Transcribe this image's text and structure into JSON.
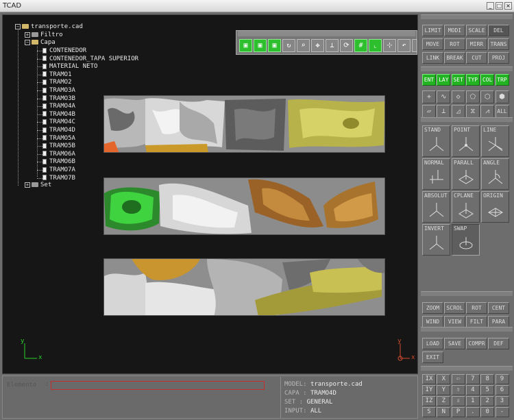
{
  "window": {
    "title": "TCAD"
  },
  "tree": {
    "root": "transporte.cad",
    "filtro": "Filtro",
    "capa": "Capa",
    "layers": [
      "CONTENEDOR",
      "CONTENEDOR_TAPA SUPERIOR",
      "MATERIAL NETO",
      "TRAMO1",
      "TRAMO2",
      "TRAMO3A",
      "TRAMO3B",
      "TRAMO4A",
      "TRAMO4B",
      "TRAMO4C",
      "TRAMO4D",
      "TRAMO5A",
      "TRAMO5B",
      "TRAMO6A",
      "TRAMO6B",
      "TRAMO7A",
      "TRAMO7B"
    ],
    "set": "Set"
  },
  "axes": {
    "left_y": "y",
    "left_x": "x",
    "right_y": "y",
    "right_x": "x"
  },
  "tools": {
    "row1": [
      "LIMIT",
      "MODI",
      "SCALE",
      "DEL"
    ],
    "row2": [
      "MOVE",
      "ROT",
      "MIRR",
      "TRANS"
    ],
    "row3": [
      "LINK",
      "BREAK",
      "CUT",
      "PROJ"
    ]
  },
  "filter": [
    "ENT",
    "LAY",
    "SET",
    "TYP",
    "COL",
    "TRP"
  ],
  "shapes": {
    "all": "ALL"
  },
  "planes": [
    "STAND",
    "POINT",
    "LINE",
    "NORMAL",
    "PARALL",
    "ANGLE",
    "ABSOLUT",
    "CPLANE",
    "ORIGIN",
    "INVERT",
    "SWAP"
  ],
  "view": {
    "row1": [
      "ZOOM",
      "SCROL",
      "ROT",
      "CENT"
    ],
    "row2": [
      "WIND",
      "VIEW",
      "FILT",
      "PARA"
    ]
  },
  "file": {
    "row1": [
      "LOAD",
      "SAVE",
      "COMPR",
      "DEF"
    ],
    "exit": "EXIT"
  },
  "keypad": [
    [
      "IX",
      "X",
      "⇦",
      "7",
      "8",
      "9"
    ],
    [
      "IY",
      "Y",
      "⇧",
      "4",
      "5",
      "6"
    ],
    [
      "IZ",
      "Z",
      "⇩",
      "1",
      "2",
      "3"
    ],
    [
      "S",
      "N",
      "P",
      ".",
      "0",
      "-"
    ]
  ],
  "element": {
    "label": "Elemento"
  },
  "status": {
    "model_key": "MODEL:",
    "model": "transporte.cad",
    "capa_key": "CAPA :",
    "capa": "TRAMO4D",
    "set_key": "SET  :",
    "set": "GENERAL",
    "input_key": "INPUT:",
    "input": "ALL"
  },
  "colors": {
    "accent_green": "#22b322",
    "viewport_bg": "#161616",
    "panel_bg": "#6d6d6d"
  }
}
